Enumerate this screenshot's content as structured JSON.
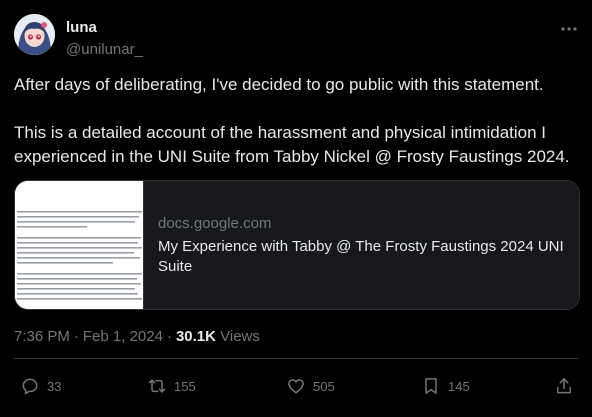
{
  "author": {
    "display_name": "luna",
    "handle": "@unilunar_"
  },
  "tweet": {
    "paragraphs": [
      "After days of deliberating, I've decided to go public with this statement.",
      "This is a detailed account of the harassment and physical intimidation I experienced in the UNI Suite from Tabby Nickel @ Frosty Faustings 2024."
    ]
  },
  "card": {
    "domain": "docs.google.com",
    "title": "My Experience with Tabby @ The Frosty Faustings 2024 UNI Suite"
  },
  "meta": {
    "time": "7:36 PM",
    "date": "Feb 1, 2024",
    "views_count": "30.1K",
    "views_label": "Views"
  },
  "actions": {
    "replies": "33",
    "reposts": "155",
    "likes": "505",
    "bookmarks": "145"
  },
  "icons": {
    "more": "more-dots-icon",
    "reply": "reply-icon",
    "repost": "repost-icon",
    "like": "heart-icon",
    "bookmark": "bookmark-icon",
    "share": "share-icon"
  },
  "colors": {
    "background": "#000000",
    "text_primary": "#e7e9ea",
    "text_secondary": "#71767b",
    "border": "#2f3336",
    "card_body": "#16181c"
  }
}
